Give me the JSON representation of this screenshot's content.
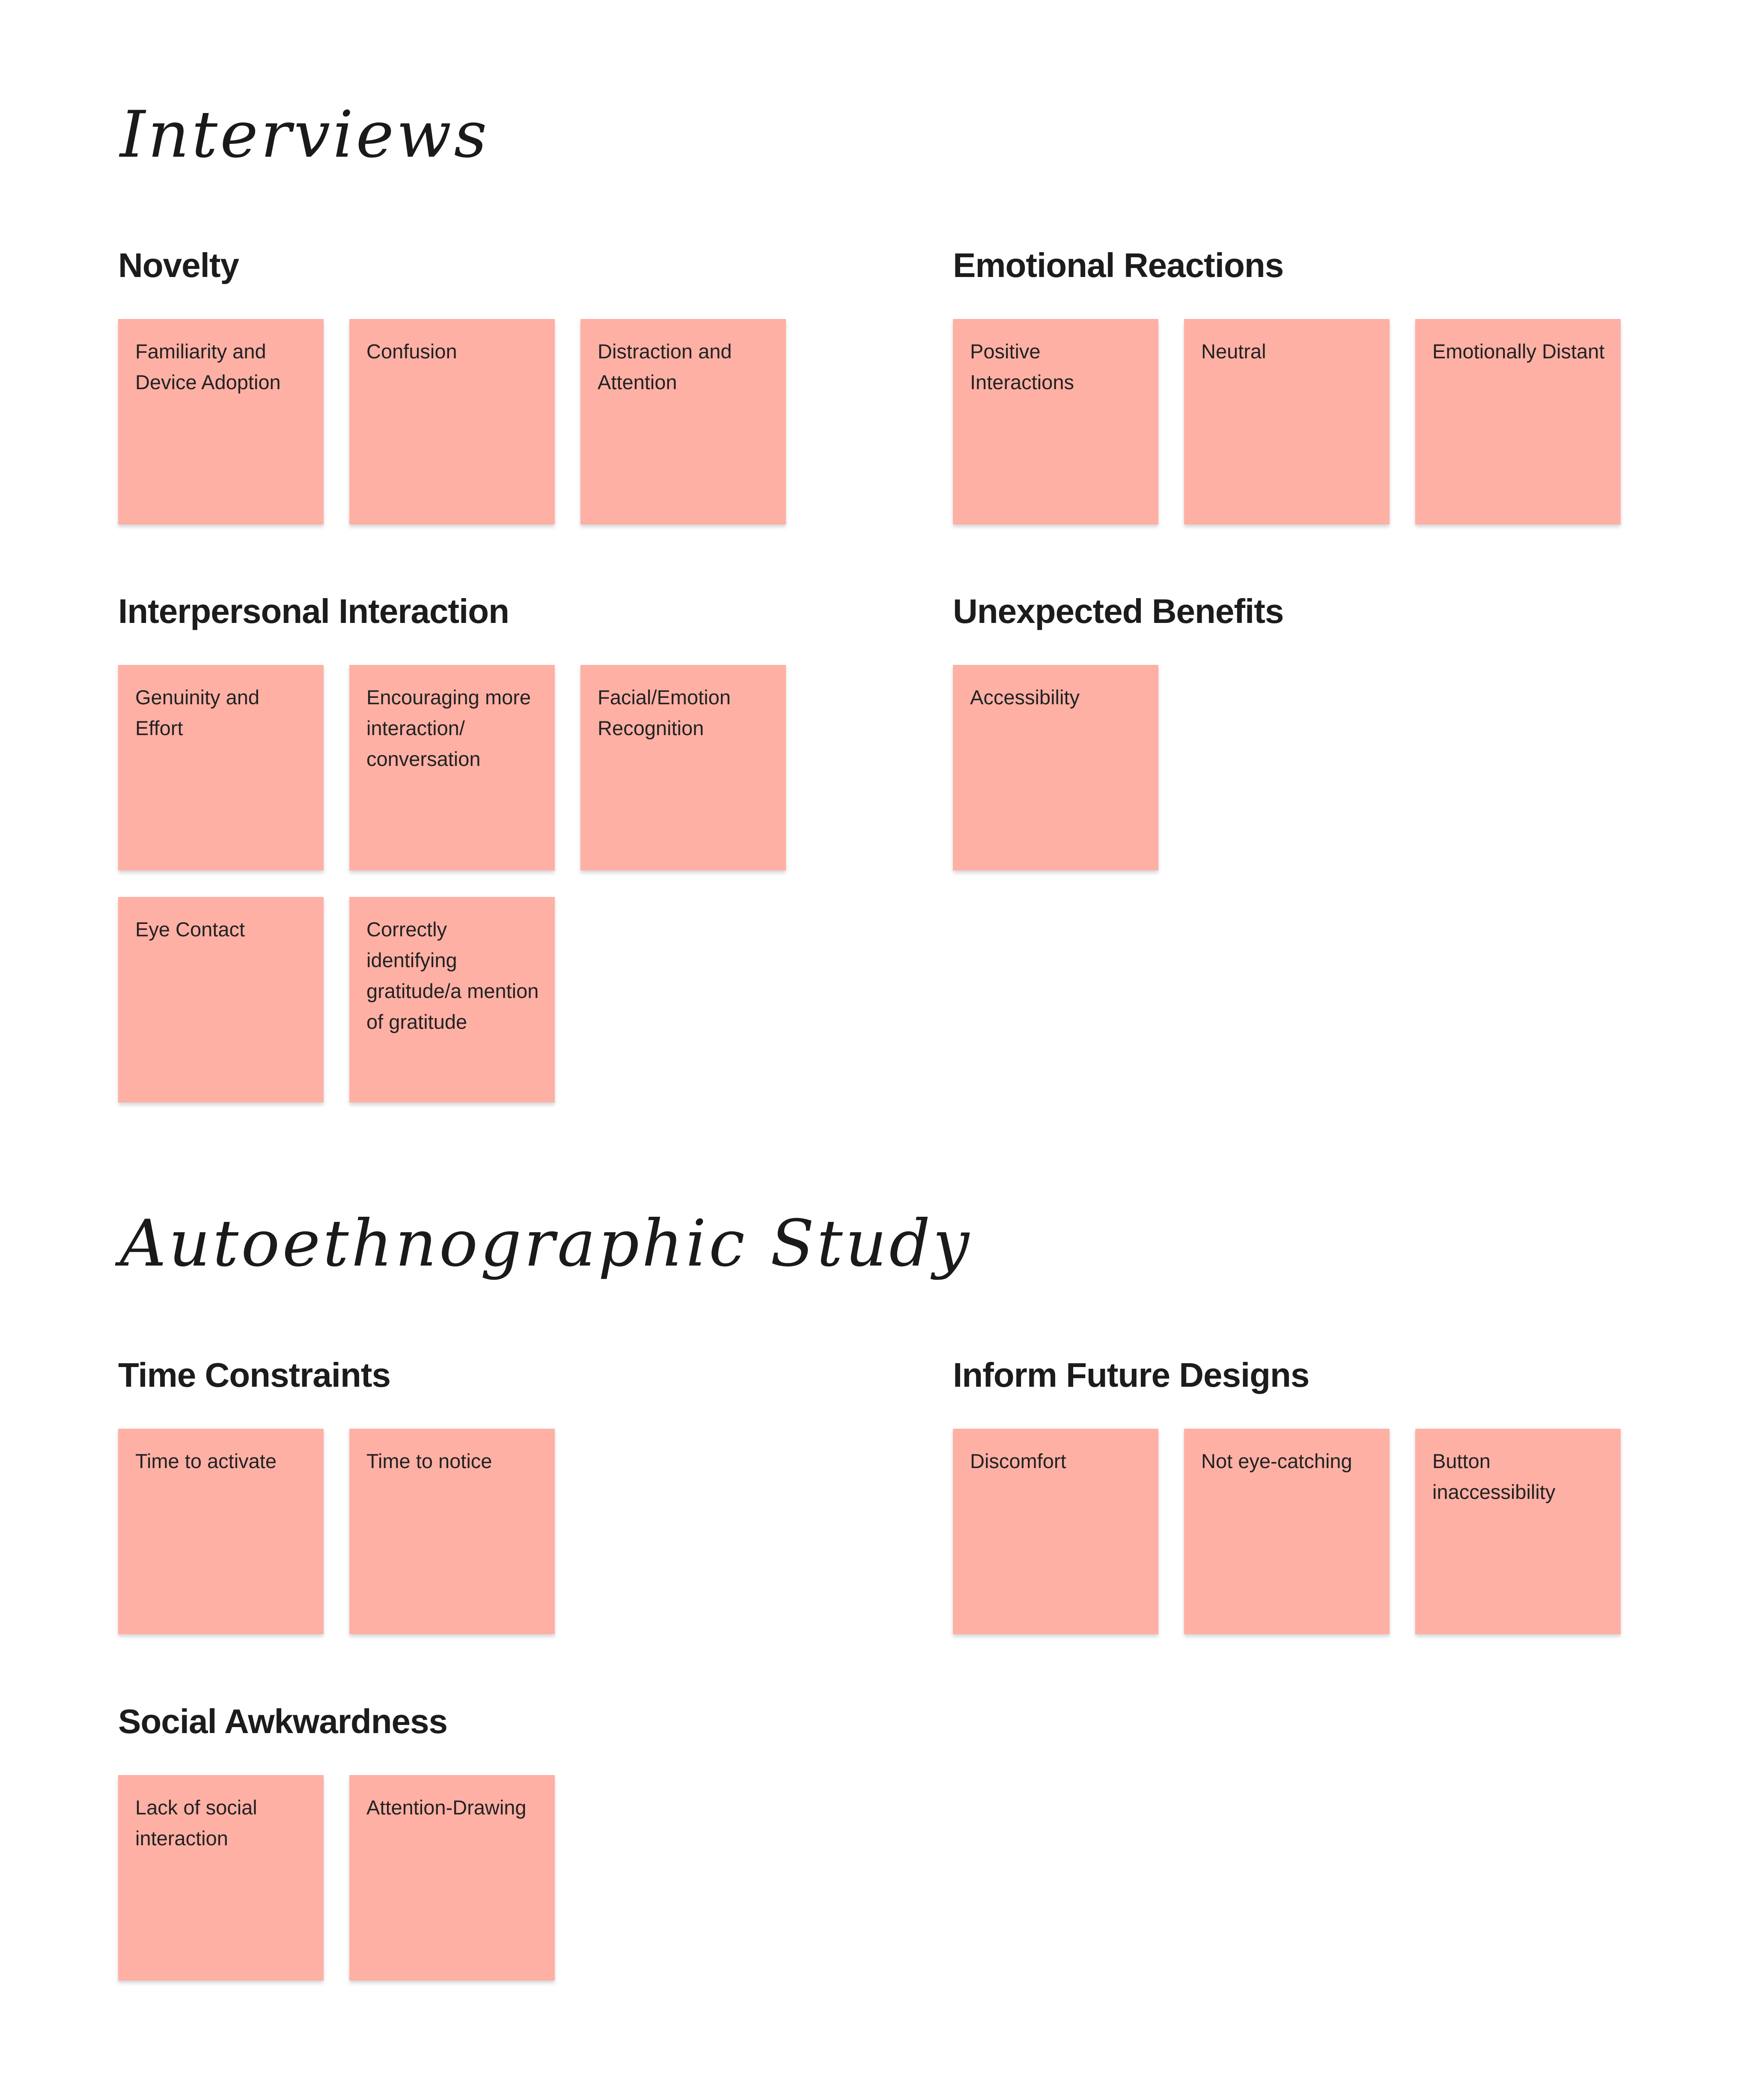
{
  "board": {
    "interviews": {
      "title": "Interviews",
      "groups": {
        "novelty": {
          "title": "Novelty",
          "notes": [
            "Familiarity and Device Adoption",
            "Confusion",
            "Distraction and Attention"
          ]
        },
        "emotional_reactions": {
          "title": "Emotional Reactions",
          "notes": [
            "Positive Interactions",
            "Neutral",
            "Emotionally Distant"
          ]
        },
        "interpersonal_interaction": {
          "title": "Interpersonal Interaction",
          "notes": [
            "Genuinity and Effort",
            "Encouraging more interaction/ conversation",
            "Facial/Emotion Recognition",
            "Eye Contact",
            "Correctly identifying gratitude/a mention of gratitude"
          ]
        },
        "unexpected_benefits": {
          "title": "Unexpected Benefits",
          "notes": [
            "Accessibility"
          ]
        }
      }
    },
    "autoethnographic": {
      "title": "Autoethnographic Study",
      "groups": {
        "time_constraints": {
          "title": "Time Constraints",
          "notes": [
            "Time to activate",
            "Time to notice"
          ]
        },
        "inform_future_designs": {
          "title": "Inform Future Designs",
          "notes": [
            "Discomfort",
            "Not eye-catching",
            "Button inaccessibility"
          ]
        },
        "social_awkwardness": {
          "title": "Social Awkwardness",
          "notes": [
            "Lack of social interaction",
            "Attention-Drawing"
          ]
        }
      }
    }
  },
  "colors": {
    "sticky_note": "#ffb0a5",
    "background": "#ffffff",
    "text": "#1c1c1c"
  }
}
